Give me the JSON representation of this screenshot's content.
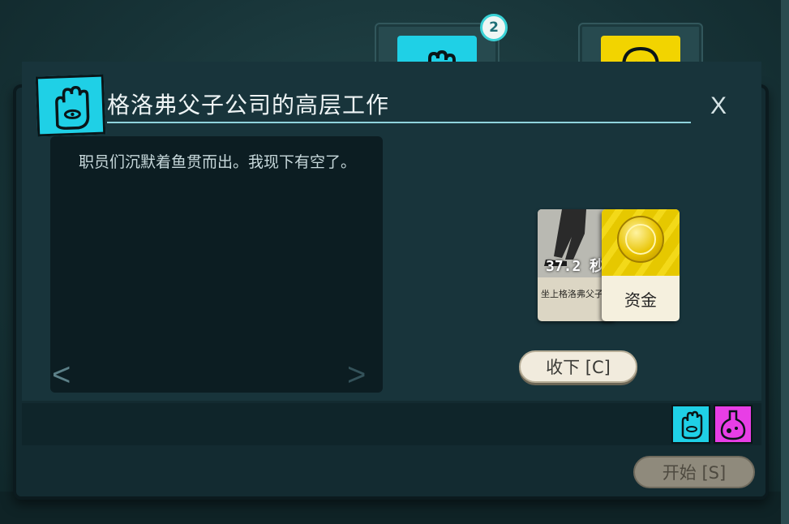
{
  "verbs": {
    "badge_count": "2",
    "tiles": [
      {
        "icon": "hand-eye-icon",
        "color": "#1fd0e6"
      },
      {
        "icon": "lightbulb-icon",
        "color": "#f2d400"
      }
    ]
  },
  "dialog": {
    "title": "格洛弗父子公司的高层工作",
    "title_icon": "hand-eye-icon",
    "close_label": "X",
    "story_text": "职员们沉默着鱼贯而出。我现下有空了。",
    "nav_prev": "<",
    "nav_next": ">"
  },
  "cards": {
    "situation": {
      "timer": "37.2 秒",
      "label": "坐上格洛弗父子公司的高层职位"
    },
    "funds": {
      "label": "资金",
      "icon": "coin-icon"
    }
  },
  "buttons": {
    "accept_label": "收下 [C]",
    "start_label": "开始 [S]"
  },
  "slots": [
    {
      "icon": "hand-eye-icon",
      "color": "#1fd0e6"
    },
    {
      "icon": "flask-icon",
      "color": "#e83ee6"
    }
  ]
}
